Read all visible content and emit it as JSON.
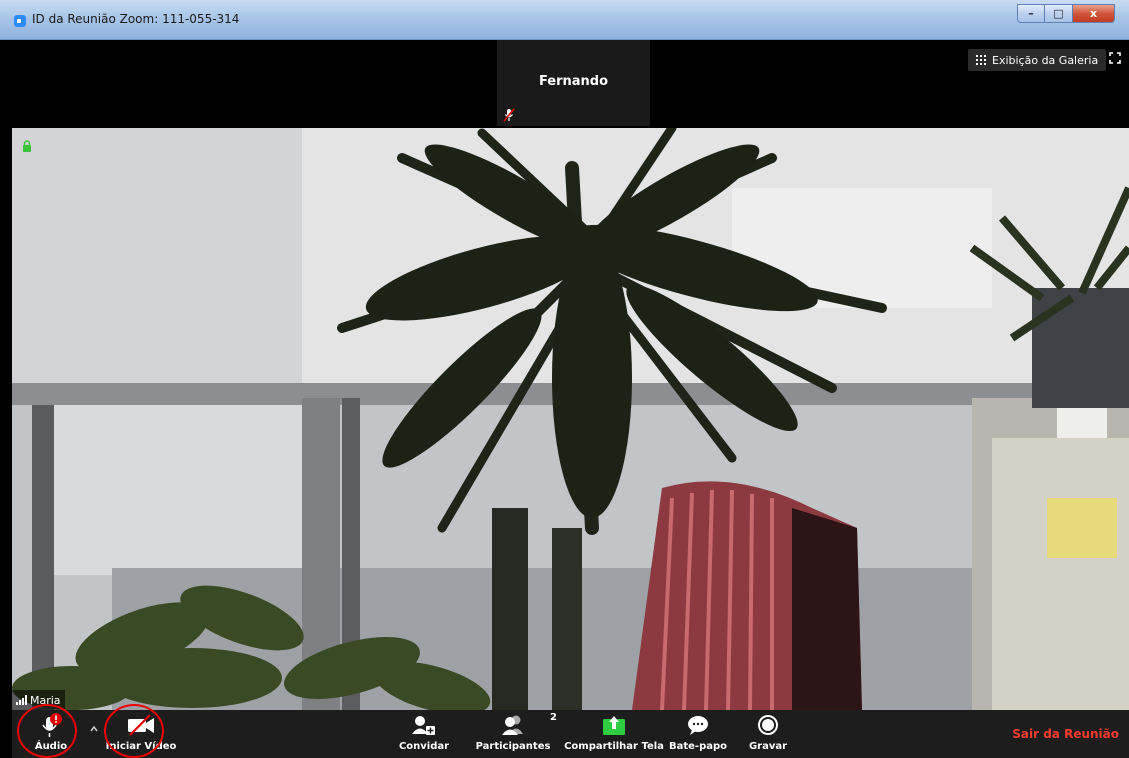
{
  "window": {
    "title": "ID da Reunião Zoom: 111-055-314",
    "minimize": "–",
    "maximize": "□",
    "close": "x"
  },
  "strip": {
    "thumb_name": "Fernando",
    "gallery_label": "Exibição da Galeria"
  },
  "video": {
    "name_tag": "Maria"
  },
  "toolbar": {
    "audio": "Áudio",
    "video": "Iniciar Vídeo",
    "invite": "Convidar",
    "participants": "Participantes",
    "participants_count": "2",
    "share": "Compartilhar Tela",
    "chat": "Bate-papo",
    "record": "Gravar",
    "leave": "Sair da Reunião"
  },
  "colors": {
    "leave": "#ff3b30",
    "share": "#2ecc40",
    "alert": "#e00000"
  }
}
